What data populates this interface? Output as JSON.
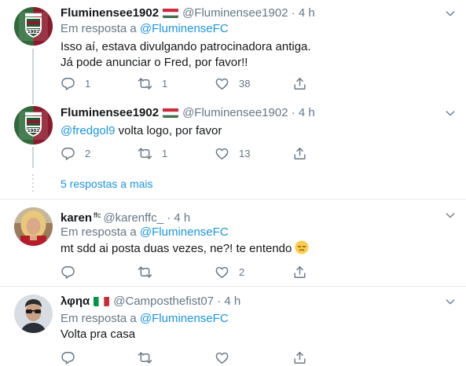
{
  "tweets": [
    {
      "name": "Fluminensee1902",
      "handle": "@Fluminensee1902",
      "sep": "·",
      "time": "4 h",
      "reply_prefix": "Em resposta a",
      "reply_to": "@FluminenseFC",
      "text_line1": "Isso aí, estava divulgando patrocinadora antiga.",
      "text_line2": "Já pode anunciar o Fred, por favor!!",
      "replies": "1",
      "retweets": "1",
      "likes": "38",
      "flag": "hungary-flag-icon"
    },
    {
      "name": "Fluminensee1902",
      "handle": "@Fluminensee1902",
      "sep": "·",
      "time": "4 h",
      "mention": "@fredgol9",
      "text": " volta logo, por favor",
      "replies": "2",
      "retweets": "1",
      "likes": "13",
      "flag": "hungary-flag-icon"
    },
    {
      "name": "karen",
      "name_suffix": "ffc",
      "handle": "@karenffc_",
      "sep": "·",
      "time": "4 h",
      "reply_prefix": "Em resposta a",
      "reply_to": "@FluminenseFC",
      "text": "mt sdd ai posta duas vezes, ne?! te entendo",
      "replies": "",
      "retweets": "",
      "likes": "2"
    },
    {
      "name": "λφηα",
      "handle": "@Camposthefist07",
      "sep": "·",
      "time": "4 h",
      "reply_prefix": "Em resposta a",
      "reply_to": "@FluminenseFC",
      "text": "Volta pra casa",
      "replies": "",
      "retweets": "",
      "likes": "",
      "flag": "italy-flag-icon"
    }
  ],
  "more_replies": "5 respostas a mais",
  "colors": {
    "link": "#1b95e0",
    "meta": "#657786",
    "text": "#14171a",
    "divider": "#e6ecf0"
  }
}
